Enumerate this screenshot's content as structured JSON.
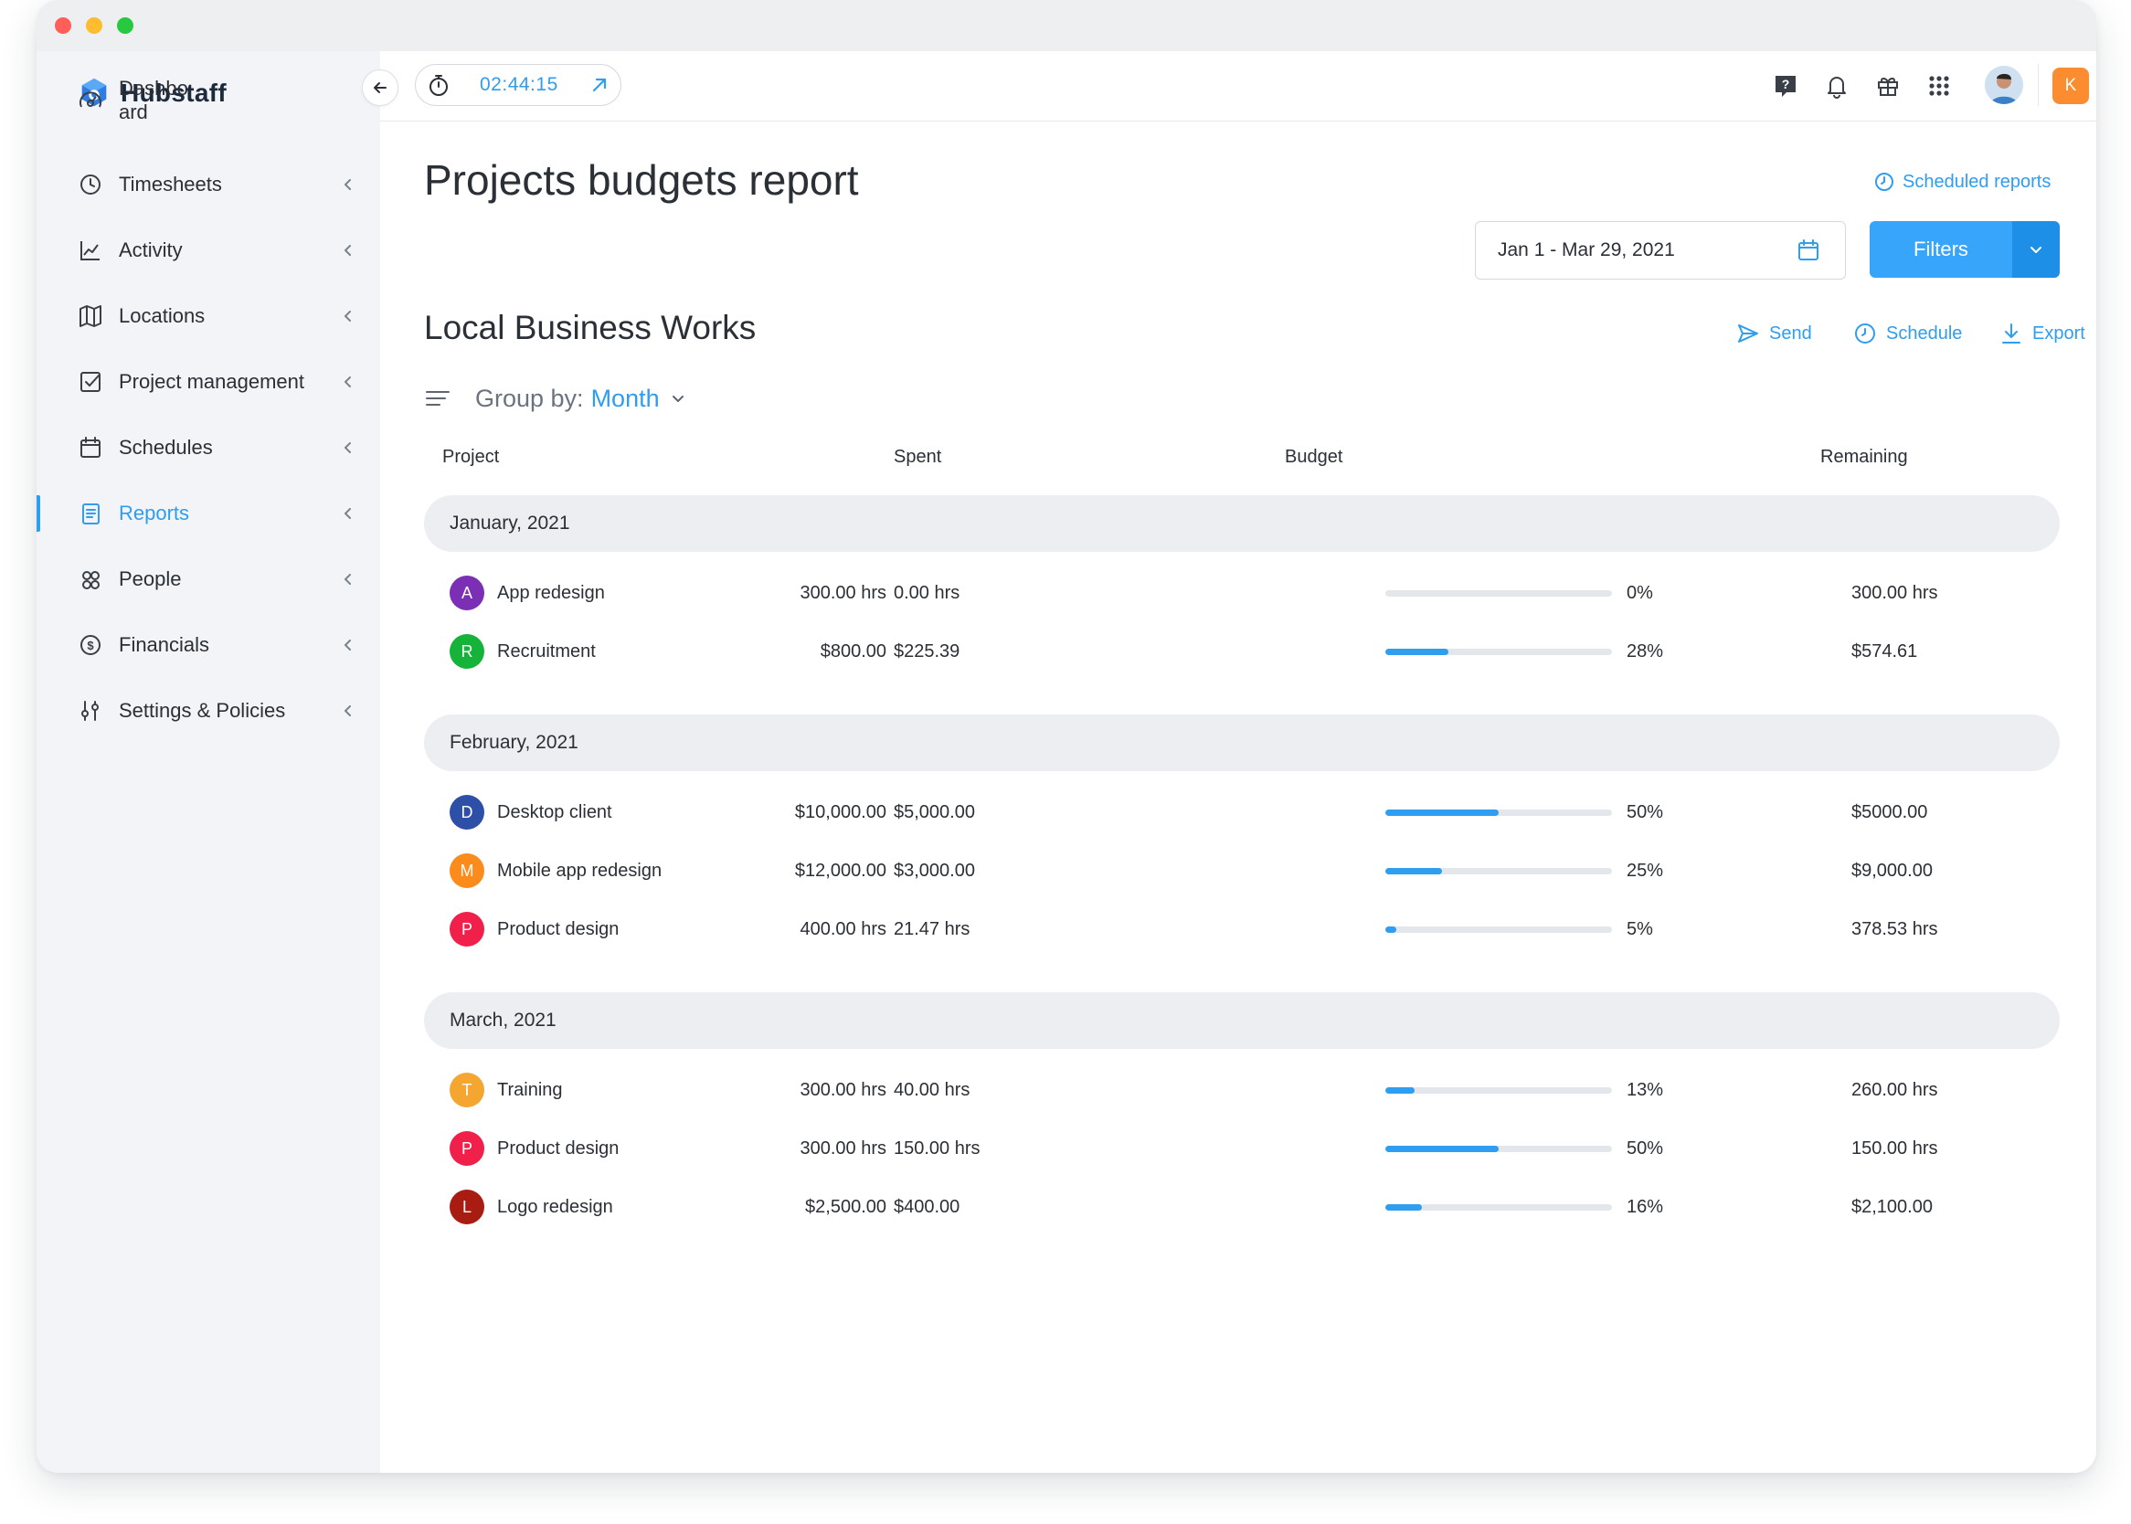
{
  "brand": {
    "name": "Hubstaff",
    "accent": "#2f9df0"
  },
  "sidebar": {
    "items": [
      {
        "label": "Dashbo\nard",
        "icon": "dashboard-gauge-icon"
      },
      {
        "label": "Timesheets",
        "icon": "clock-icon"
      },
      {
        "label": "Activity",
        "icon": "activity-chart-icon"
      },
      {
        "label": "Locations",
        "icon": "map-icon"
      },
      {
        "label": "Project management",
        "icon": "checkbox-icon"
      },
      {
        "label": "Schedules",
        "icon": "calendar-icon"
      },
      {
        "label": "Reports",
        "icon": "report-document-icon",
        "active": true
      },
      {
        "label": "People",
        "icon": "people-icon"
      },
      {
        "label": "Financials",
        "icon": "dollar-coin-icon"
      },
      {
        "label": "Settings & Policies",
        "icon": "settings-sliders-icon"
      }
    ]
  },
  "topbar": {
    "timer": "02:44:15",
    "icons": [
      "help-icon",
      "bell-icon",
      "gift-icon",
      "apps-grid-icon"
    ],
    "user_initial": "K"
  },
  "page": {
    "title": "Projects budgets report",
    "scheduled_reports": "Scheduled reports",
    "date_range": "Jan 1 - Mar 29, 2021",
    "filters_label": "Filters",
    "organization": "Local Business Works",
    "actions": {
      "send": "Send",
      "schedule": "Schedule",
      "export": "Export"
    },
    "group_by_label": "Group by:",
    "group_by_value": "Month"
  },
  "table": {
    "columns": [
      "Project",
      "Spent",
      "Budget",
      "Remaining"
    ],
    "groups": [
      {
        "label": "January, 2021",
        "rows": [
          {
            "initial": "A",
            "color": "#7b2fb5",
            "name": "App redesign",
            "spent": "0.00 hrs",
            "budget": "300.00 hrs",
            "progress": 0,
            "pct": "0%",
            "remaining": "300.00 hrs"
          },
          {
            "initial": "R",
            "color": "#16b33a",
            "name": "Recruitment",
            "spent": "$225.39",
            "budget": "$800.00",
            "progress": 28,
            "pct": "28%",
            "remaining": "$574.61"
          }
        ]
      },
      {
        "label": "February, 2021",
        "rows": [
          {
            "initial": "D",
            "color": "#2e4fa8",
            "name": "Desktop client",
            "spent": "$5,000.00",
            "budget": "$10,000.00",
            "progress": 50,
            "pct": "50%",
            "remaining": "$5000.00"
          },
          {
            "initial": "M",
            "color": "#fb8c1c",
            "name": "Mobile app redesign",
            "spent": "$3,000.00",
            "budget": "$12,000.00",
            "progress": 25,
            "pct": "25%",
            "remaining": "$9,000.00"
          },
          {
            "initial": "P",
            "color": "#f0204a",
            "name": "Product design",
            "spent": "21.47 hrs",
            "budget": "400.00 hrs",
            "progress": 5,
            "pct": "5%",
            "remaining": "378.53 hrs"
          }
        ]
      },
      {
        "label": "March, 2021",
        "rows": [
          {
            "initial": "T",
            "color": "#f5a631",
            "name": "Training",
            "spent": "40.00 hrs",
            "budget": "300.00 hrs",
            "progress": 13,
            "pct": "13%",
            "remaining": "260.00 hrs"
          },
          {
            "initial": "P",
            "color": "#f0204a",
            "name": "Product design",
            "spent": "150.00 hrs",
            "budget": "300.00 hrs",
            "progress": 50,
            "pct": "50%",
            "remaining": "150.00 hrs"
          },
          {
            "initial": "L",
            "color": "#a81c12",
            "name": "Logo redesign",
            "spent": "$400.00",
            "budget": "$2,500.00",
            "progress": 16,
            "pct": "16%",
            "remaining": "$2,100.00"
          }
        ]
      }
    ]
  }
}
